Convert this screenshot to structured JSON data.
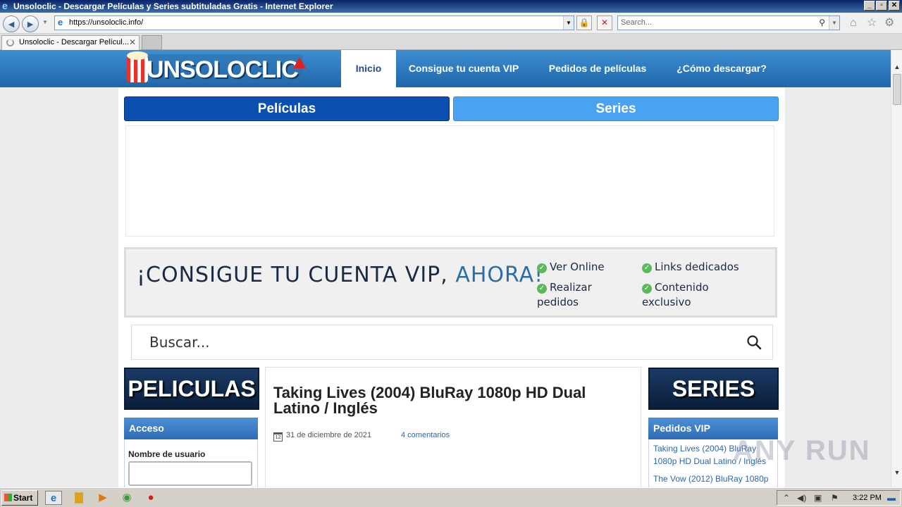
{
  "window": {
    "title": "Unsoloclic - Descargar Películas y Series subtituladas Gratis - Internet Explorer",
    "controls": {
      "minimize": "_",
      "restore": "▫",
      "close": "✕"
    }
  },
  "browser": {
    "address": "https://unsoloclic.info/",
    "search_placeholder": "Search...",
    "tab_label": "Unsoloclic - Descargar Películ...",
    "tab_close": "✕"
  },
  "site": {
    "logo_text": "UNSOLOCLIC",
    "menu": [
      {
        "label": "Inicio",
        "active": true
      },
      {
        "label": "Consigue tu cuenta VIP",
        "active": false
      },
      {
        "label": "Pedidos de películas",
        "active": false
      },
      {
        "label": "¿Cómo descargar?",
        "active": false
      }
    ],
    "tabs": {
      "peliculas": "Películas",
      "series": "Series"
    },
    "vip_banner": {
      "headline": "¡CONSIGUE TU CUENTA VIP, ",
      "headline_accent": "AHORA!",
      "features": [
        "Ver Online",
        "Links dedicados",
        "Realizar pedidos",
        "Contenido exclusivo"
      ]
    },
    "search_placeholder": "Buscar...",
    "left": {
      "banner": "PELICULAS",
      "access_title": "Acceso",
      "username_label": "Nombre de usuario"
    },
    "post": {
      "title": "Taking Lives (2004) BluRay 1080p HD Dual Latino / Inglés",
      "date": "31 de diciembre de 2021",
      "comments": "4 comentarios",
      "calendar_day": "12"
    },
    "right": {
      "banner": "SERIES",
      "vip_title": "Pedidos VIP",
      "items": [
        "Taking Lives (2004) BluRay 1080p HD Dual Latino / Inglés",
        "The Vow (2012) BluRay 1080p"
      ]
    }
  },
  "watermark": "ANY RUN",
  "taskbar": {
    "start_label": "Start",
    "clock": "3:22 PM"
  },
  "colors": {
    "header_blue": "#2a78c2",
    "peliculas_tab": "#0b4fb0",
    "series_tab": "#4aa2f2",
    "check_green": "#5cb85c",
    "ahora_blue": "#2b6ea6"
  }
}
